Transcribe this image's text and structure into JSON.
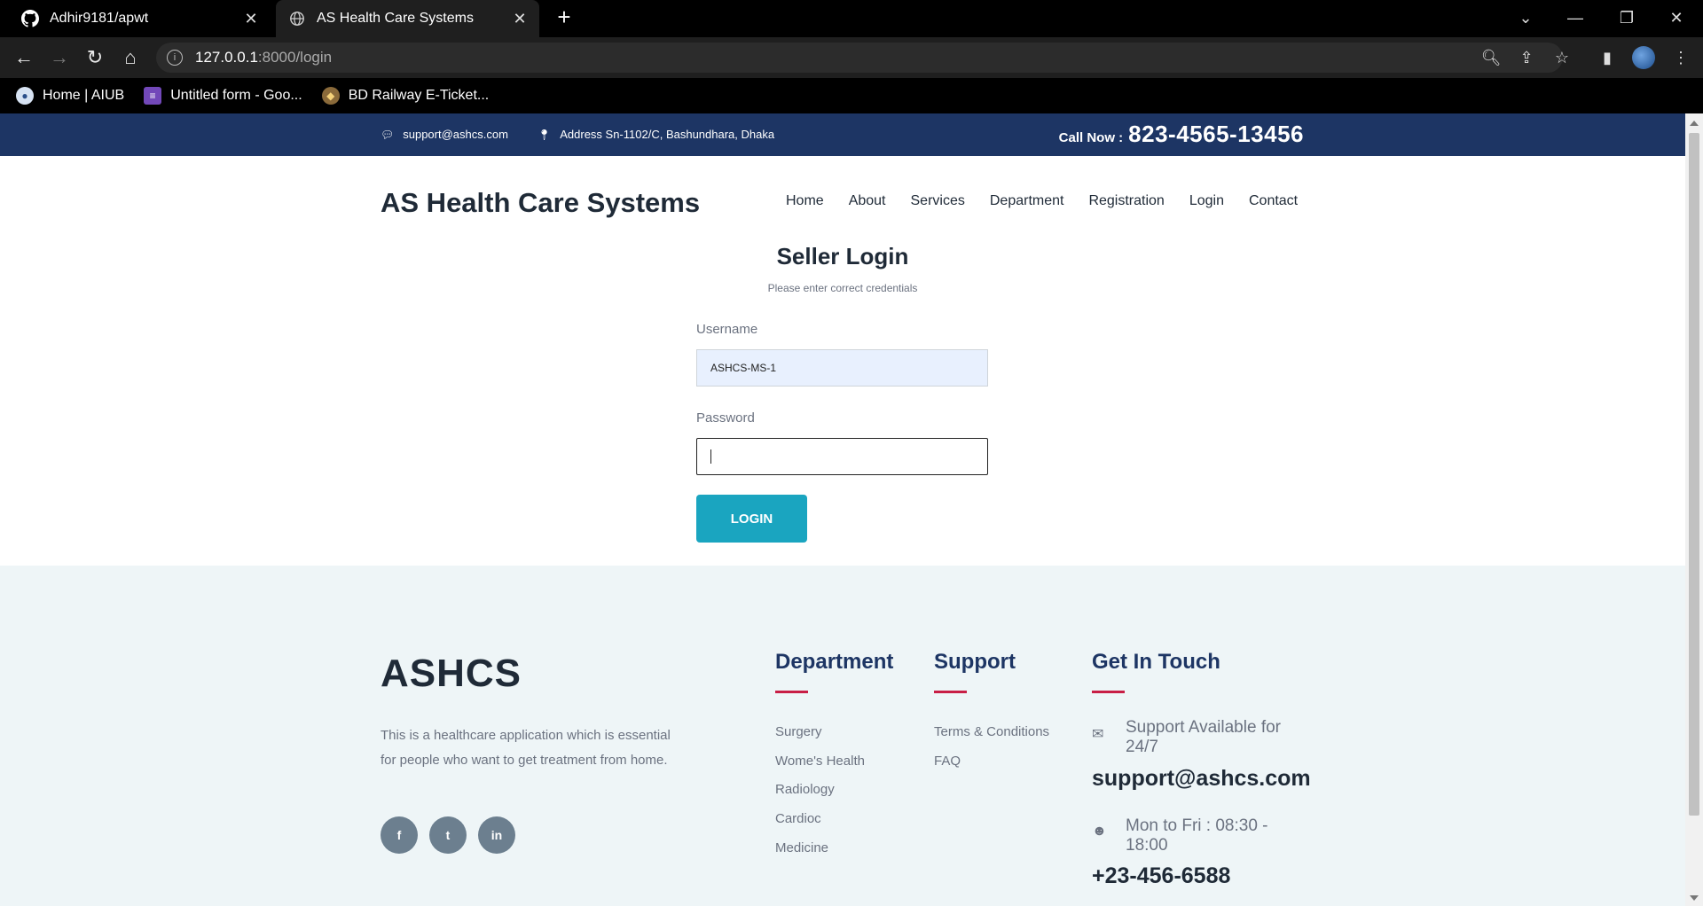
{
  "browser": {
    "tabs": [
      {
        "title": "Adhir9181/apwt",
        "icon": "github-icon",
        "active": false
      },
      {
        "title": "AS Health Care Systems",
        "icon": "globe-icon",
        "active": true
      }
    ],
    "url_host": "127.0.0.1",
    "url_path": ":8000/login",
    "bookmarks": [
      {
        "label": "Home | AIUB",
        "icon": "aiub-icon"
      },
      {
        "label": "Untitled form - Goo...",
        "icon": "google-forms-icon"
      },
      {
        "label": "BD Railway E-Ticket...",
        "icon": "railway-icon"
      }
    ]
  },
  "topbar": {
    "email": "support@ashcs.com",
    "address": "Address Sn-1102/C, Bashundhara, Dhaka",
    "call_label": "Call Now :",
    "call_number": "823-4565-13456"
  },
  "header": {
    "brand": "AS Health Care Systems",
    "nav": [
      "Home",
      "About",
      "Services",
      "Department",
      "Registration",
      "Login",
      "Contact"
    ]
  },
  "login": {
    "title": "Seller Login",
    "subtitle": "Please enter correct credentials",
    "username_label": "Username",
    "username_value": "ASHCS-MS-1",
    "password_label": "Password",
    "password_value": "",
    "button": "LOGIN"
  },
  "footer": {
    "brand": "ASHCS",
    "description": "This is a healthcare application which is essential for people who want to get treatment from home.",
    "social": [
      {
        "label": "f",
        "icon": "facebook-icon"
      },
      {
        "label": "t",
        "icon": "twitter-icon"
      },
      {
        "label": "in",
        "icon": "linkedin-icon"
      }
    ],
    "department_title": "Department",
    "department_links": [
      "Surgery",
      "Wome's Health",
      "Radiology",
      "Cardioc",
      "Medicine"
    ],
    "support_title": "Support",
    "support_links": [
      "Terms & Conditions",
      "FAQ"
    ],
    "contact_title": "Get In Touch",
    "support_available": "Support Available for 24/7",
    "support_email": "support@ashcs.com",
    "hours": "Mon to Fri : 08:30 - 18:00",
    "phone": "+23-456-6588"
  },
  "colors": {
    "topbar": "#1d3564",
    "button": "#1aa5c0",
    "accent": "#c81e45",
    "footer_bg": "#eef5f7"
  }
}
